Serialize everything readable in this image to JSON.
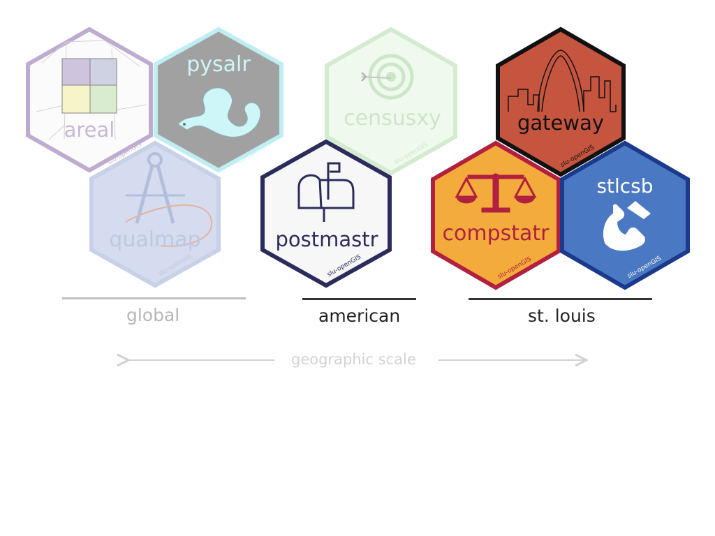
{
  "hexes": {
    "areal": {
      "name": "areal",
      "footer": "slu-openGIS",
      "border": "#b8a4cb",
      "fill": "#fbfbfb",
      "text": "#c1b1d2"
    },
    "pysalr": {
      "name": "pysalr",
      "footer": "slu-openGIS",
      "border": "#b8ecf1",
      "fill": "#979797",
      "text": "#c9f4f8"
    },
    "qualmap": {
      "name": "qualmap",
      "footer": "slu-openGIS",
      "border": "#b5c2e0",
      "fill": "#c7d1ea",
      "text": "#a8b6d9"
    },
    "censusxy": {
      "name": "censusxy",
      "footer": "slu-openGIS",
      "border": "#cde8c8",
      "fill": "#eef8ec",
      "text": "#c4e3bf"
    },
    "postmastr": {
      "name": "postmastr",
      "footer": "slu-openGIS",
      "border": "#2c2c5c",
      "fill": "#f7f7f7",
      "text": "#2c2c5c"
    },
    "gateway": {
      "name": "gateway",
      "footer": "slu-openGIS",
      "border": "#111111",
      "fill": "#c65540",
      "text": "#111111"
    },
    "compstatr": {
      "name": "compstatr",
      "footer": "slu-openGIS",
      "border": "#b1203e",
      "fill": "#f3ac3b",
      "text": "#b1203e"
    },
    "stlcsb": {
      "name": "stlcsb",
      "footer": "slu-openGIS",
      "border": "#1b3a8c",
      "fill": "#4a78c2",
      "text": "#ffffff"
    }
  },
  "groups": {
    "global": "global",
    "american": "american",
    "st_louis": "st. louis"
  },
  "scale": {
    "label": "geographic scale"
  }
}
